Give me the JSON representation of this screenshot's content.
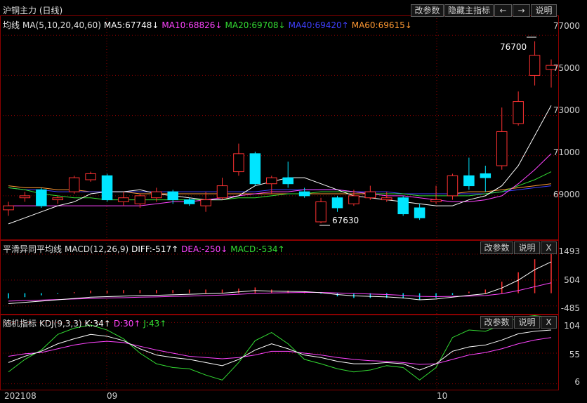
{
  "title": "沪铜主力 (日线)",
  "main_buttons": [
    "改参数",
    "隐藏主指标",
    "←",
    "→",
    "说明"
  ],
  "ma_header": {
    "name": "均线",
    "params": "MA(5,10,20,40,60)",
    "items": [
      {
        "label": "MA5:67748↓",
        "color": "#ffffff"
      },
      {
        "label": "MA10:68826↓",
        "color": "#ff44ff"
      },
      {
        "label": "MA20:69708↓",
        "color": "#33dd33"
      },
      {
        "label": "MA40:69420↑",
        "color": "#4040ff"
      },
      {
        "label": "MA60:69615↓",
        "color": "#ff9933"
      }
    ]
  },
  "price_axis": [
    "77000",
    "75000",
    "73000",
    "71000",
    "69000"
  ],
  "annotations": {
    "high": "76700",
    "low": "67630"
  },
  "macd_header": {
    "name": "平滑异同平均线",
    "params": "MACD(12,26,9)",
    "items": [
      {
        "label": "DIFF:-517↑",
        "color": "#ffffff"
      },
      {
        "label": "DEA:-250↓",
        "color": "#ff44ff"
      },
      {
        "label": "MACD:-534↑",
        "color": "#33dd33"
      }
    ]
  },
  "macd_buttons": [
    "改参数",
    "说明",
    "X"
  ],
  "macd_axis": [
    "1493",
    "504",
    "-485"
  ],
  "kdj_header": {
    "name": "随机指标",
    "params": "KDJ(9,3,3)",
    "items": [
      {
        "label": "K:34↑",
        "color": "#ffffff"
      },
      {
        "label": "D:30↑",
        "color": "#ff44ff"
      },
      {
        "label": "J:43↑",
        "color": "#33dd33"
      }
    ]
  },
  "kdj_buttons": [
    "改参数",
    "说明",
    "X"
  ],
  "kdj_axis": [
    "104",
    "55",
    "6"
  ],
  "date_axis": [
    "202108",
    "09",
    "10"
  ],
  "colors": {
    "up": "#ff3232",
    "down": "#00e5ff",
    "ma5": "#ffffff",
    "ma10": "#ff44ff",
    "ma20": "#33dd33",
    "ma40": "#4040ff",
    "ma60": "#ff9933",
    "grid": "#8b0000"
  },
  "chart_data": {
    "type": "candlestick",
    "ylim": [
      67000,
      77500
    ],
    "candles": [
      {
        "o": 68300,
        "c": 68500,
        "h": 68700,
        "l": 68000
      },
      {
        "o": 68900,
        "c": 69000,
        "h": 69200,
        "l": 68700
      },
      {
        "o": 69300,
        "c": 68500,
        "h": 69400,
        "l": 68400
      },
      {
        "o": 68800,
        "c": 68900,
        "h": 69000,
        "l": 68600
      },
      {
        "o": 69200,
        "c": 69900,
        "h": 70000,
        "l": 69100
      },
      {
        "o": 69800,
        "c": 70100,
        "h": 70200,
        "l": 69700
      },
      {
        "o": 70000,
        "c": 68800,
        "h": 70100,
        "l": 68700
      },
      {
        "o": 68700,
        "c": 68900,
        "h": 69200,
        "l": 68500
      },
      {
        "o": 68600,
        "c": 69000,
        "h": 69100,
        "l": 68400
      },
      {
        "o": 68900,
        "c": 69200,
        "h": 69400,
        "l": 68700
      },
      {
        "o": 69200,
        "c": 68800,
        "h": 69300,
        "l": 68600
      },
      {
        "o": 68800,
        "c": 68600,
        "h": 68900,
        "l": 68500
      },
      {
        "o": 68500,
        "c": 68800,
        "h": 69200,
        "l": 68200
      },
      {
        "o": 68900,
        "c": 69500,
        "h": 69900,
        "l": 68800
      },
      {
        "o": 70200,
        "c": 71100,
        "h": 71600,
        "l": 70000
      },
      {
        "o": 71100,
        "c": 69600,
        "h": 71200,
        "l": 69500
      },
      {
        "o": 69600,
        "c": 69900,
        "h": 70000,
        "l": 69100
      },
      {
        "o": 69900,
        "c": 69600,
        "h": 70700,
        "l": 69400
      },
      {
        "o": 69200,
        "c": 69000,
        "h": 69400,
        "l": 68900
      },
      {
        "o": 67700,
        "c": 68700,
        "h": 68900,
        "l": 67630
      },
      {
        "o": 68900,
        "c": 68400,
        "h": 69000,
        "l": 68200
      },
      {
        "o": 68600,
        "c": 69000,
        "h": 69300,
        "l": 68500
      },
      {
        "o": 68900,
        "c": 69200,
        "h": 69500,
        "l": 68800
      },
      {
        "o": 68800,
        "c": 68900,
        "h": 69200,
        "l": 68700
      },
      {
        "o": 68900,
        "c": 68100,
        "h": 69000,
        "l": 68000
      },
      {
        "o": 68400,
        "c": 67900,
        "h": 68600,
        "l": 67800
      },
      {
        "o": 68700,
        "c": 68800,
        "h": 69500,
        "l": 68600
      },
      {
        "o": 69000,
        "c": 70000,
        "h": 70100,
        "l": 68800
      },
      {
        "o": 70000,
        "c": 69500,
        "h": 70900,
        "l": 69300
      },
      {
        "o": 70100,
        "c": 69900,
        "h": 70500,
        "l": 69200
      },
      {
        "o": 70500,
        "c": 72200,
        "h": 73400,
        "l": 70300
      },
      {
        "o": 72600,
        "c": 73700,
        "h": 74200,
        "l": 72500
      },
      {
        "o": 75000,
        "c": 76000,
        "h": 76700,
        "l": 74500
      },
      {
        "o": 75300,
        "c": 75500,
        "h": 75800,
        "l": 74400
      }
    ],
    "ma5": [
      67600,
      67900,
      68200,
      68500,
      68700,
      69100,
      69200,
      69200,
      69300,
      69100,
      69000,
      68900,
      68800,
      68800,
      69000,
      69500,
      69700,
      69900,
      69900,
      69600,
      69300,
      69000,
      68900,
      68800,
      68700,
      68600,
      68500,
      68500,
      68800,
      69000,
      69500,
      70500,
      72000,
      73500
    ],
    "ma10": [
      68500,
      68500,
      68500,
      68500,
      68500,
      68500,
      68500,
      68500,
      68500,
      68600,
      68700,
      68700,
      68800,
      68900,
      69000,
      69100,
      69200,
      69200,
      69300,
      69300,
      69300,
      69200,
      69100,
      69000,
      69000,
      68900,
      68800,
      68700,
      68700,
      68800,
      69000,
      69600,
      70300,
      71100
    ],
    "ma20": [
      69400,
      69300,
      69100,
      69000,
      68900,
      68900,
      68800,
      68800,
      68800,
      68800,
      68800,
      68800,
      68800,
      68800,
      68900,
      68900,
      69000,
      69100,
      69100,
      69200,
      69200,
      69200,
      69100,
      69100,
      69100,
      69000,
      69000,
      69000,
      69000,
      69100,
      69200,
      69500,
      69800,
      70200
    ],
    "ma40": [
      69400,
      69300,
      69300,
      69200,
      69200,
      69200,
      69200,
      69200,
      69200,
      69200,
      69200,
      69200,
      69200,
      69200,
      69200,
      69200,
      69300,
      69300,
      69300,
      69300,
      69300,
      69200,
      69200,
      69200,
      69100,
      69100,
      69100,
      69100,
      69100,
      69100,
      69200,
      69300,
      69400,
      69500
    ],
    "ma60": [
      69500,
      69400,
      69400,
      69300,
      69300,
      69200,
      69200,
      69200,
      69100,
      69100,
      69100,
      69100,
      69100,
      69100,
      69100,
      69100,
      69100,
      69100,
      69100,
      69100,
      69100,
      69100,
      69100,
      69100,
      69100,
      69100,
      69100,
      69100,
      69200,
      69200,
      69300,
      69400,
      69500,
      69600
    ],
    "macd": {
      "ylim": [
        -600,
        1600
      ],
      "diff": [
        -400,
        -350,
        -300,
        -250,
        -200,
        -150,
        -130,
        -110,
        -90,
        -80,
        -60,
        -40,
        -20,
        0,
        50,
        100,
        80,
        70,
        60,
        20,
        -50,
        -100,
        -120,
        -140,
        -180,
        -250,
        -220,
        -150,
        -80,
        -20,
        200,
        500,
        900,
        1200
      ],
      "dea": [
        -300,
        -280,
        -260,
        -240,
        -220,
        -200,
        -180,
        -170,
        -150,
        -140,
        -120,
        -110,
        -90,
        -70,
        -40,
        -10,
        10,
        20,
        30,
        30,
        10,
        -10,
        -30,
        -50,
        -80,
        -120,
        -130,
        -120,
        -110,
        -90,
        -20,
        100,
        250,
        400
      ],
      "hist": [
        -200,
        -150,
        -80,
        -30,
        40,
        100,
        100,
        120,
        120,
        120,
        120,
        140,
        140,
        140,
        180,
        220,
        140,
        100,
        60,
        -20,
        -120,
        -180,
        -180,
        -180,
        -200,
        -260,
        -180,
        -60,
        60,
        140,
        440,
        800,
        1300,
        1600
      ]
    },
    "kdj": {
      "ylim": [
        0,
        110
      ],
      "k": [
        40,
        50,
        58,
        70,
        78,
        85,
        82,
        75,
        62,
        52,
        48,
        45,
        40,
        35,
        45,
        60,
        70,
        62,
        52,
        48,
        42,
        38,
        38,
        40,
        38,
        28,
        38,
        58,
        65,
        68,
        76,
        86,
        90,
        92
      ],
      "d": [
        50,
        54,
        56,
        62,
        68,
        72,
        74,
        72,
        66,
        60,
        55,
        50,
        48,
        46,
        48,
        52,
        58,
        58,
        55,
        52,
        48,
        45,
        43,
        42,
        40,
        37,
        38,
        45,
        52,
        56,
        62,
        70,
        76,
        80
      ],
      "j": [
        25,
        45,
        60,
        85,
        95,
        100,
        92,
        78,
        55,
        38,
        32,
        30,
        20,
        12,
        40,
        75,
        88,
        70,
        45,
        38,
        30,
        25,
        28,
        35,
        32,
        12,
        32,
        80,
        92,
        90,
        100,
        112,
        115,
        112
      ]
    }
  }
}
